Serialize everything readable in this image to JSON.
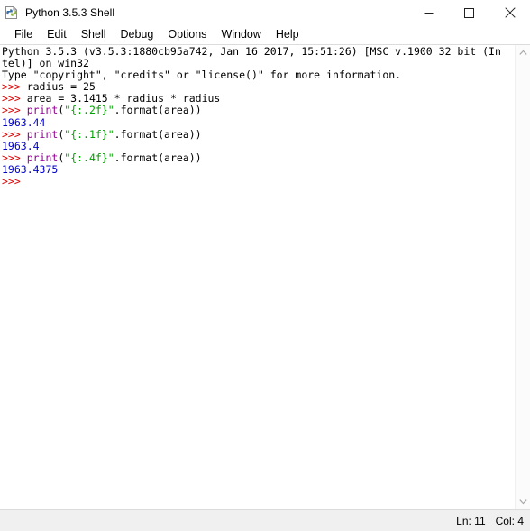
{
  "window": {
    "title": "Python 3.5.3 Shell",
    "icon": "python-idle-icon",
    "controls": {
      "minimize": "minimize-icon",
      "maximize": "maximize-icon",
      "close": "close-icon"
    }
  },
  "menubar": {
    "items": [
      {
        "label": "File"
      },
      {
        "label": "Edit"
      },
      {
        "label": "Shell"
      },
      {
        "label": "Debug"
      },
      {
        "label": "Options"
      },
      {
        "label": "Window"
      },
      {
        "label": "Help"
      }
    ]
  },
  "console": {
    "lines": [
      {
        "segments": [
          {
            "text": "Python 3.5.3 (v3.5.3:1880cb95a742, Jan 16 2017, 15:51:26) [MSC v.1900 32 bit (In",
            "color": "black"
          }
        ]
      },
      {
        "segments": [
          {
            "text": "tel)] on win32",
            "color": "black"
          }
        ]
      },
      {
        "segments": [
          {
            "text": "Type \"copyright\", \"credits\" or \"license()\" for more information.",
            "color": "black"
          }
        ]
      },
      {
        "segments": [
          {
            "text": ">>> ",
            "color": "red"
          },
          {
            "text": "radius = 25",
            "color": "black"
          }
        ]
      },
      {
        "segments": [
          {
            "text": ">>> ",
            "color": "red"
          },
          {
            "text": "area = 3.1415 * radius * radius",
            "color": "black"
          }
        ]
      },
      {
        "segments": [
          {
            "text": ">>> ",
            "color": "red"
          },
          {
            "text": "print",
            "color": "purple"
          },
          {
            "text": "(",
            "color": "black"
          },
          {
            "text": "\"{:.2f}\"",
            "color": "green"
          },
          {
            "text": ".format(area))",
            "color": "black"
          }
        ]
      },
      {
        "segments": [
          {
            "text": "1963.44",
            "color": "blue"
          }
        ]
      },
      {
        "segments": [
          {
            "text": ">>> ",
            "color": "red"
          },
          {
            "text": "print",
            "color": "purple"
          },
          {
            "text": "(",
            "color": "black"
          },
          {
            "text": "\"{:.1f}\"",
            "color": "green"
          },
          {
            "text": ".format(area))",
            "color": "black"
          }
        ]
      },
      {
        "segments": [
          {
            "text": "1963.4",
            "color": "blue"
          }
        ]
      },
      {
        "segments": [
          {
            "text": ">>> ",
            "color": "red"
          },
          {
            "text": "print",
            "color": "purple"
          },
          {
            "text": "(",
            "color": "black"
          },
          {
            "text": "\"{:.4f}\"",
            "color": "green"
          },
          {
            "text": ".format(area))",
            "color": "black"
          }
        ]
      },
      {
        "segments": [
          {
            "text": "1963.4375",
            "color": "blue"
          }
        ]
      },
      {
        "segments": [
          {
            "text": ">>> ",
            "color": "red"
          }
        ]
      }
    ]
  },
  "scrollbar": {
    "up_arrow": "scroll-up-icon",
    "down_arrow": "scroll-down-icon"
  },
  "statusbar": {
    "line": "Ln: 11",
    "column": "Col: 4"
  },
  "colors": {
    "prompt": "#dd0000",
    "keyword": "#900090",
    "string": "#00a000",
    "output": "#0000cc",
    "text": "#000000",
    "titlebar_bg": "#ffffff",
    "statusbar_bg": "#f0f0f0"
  }
}
